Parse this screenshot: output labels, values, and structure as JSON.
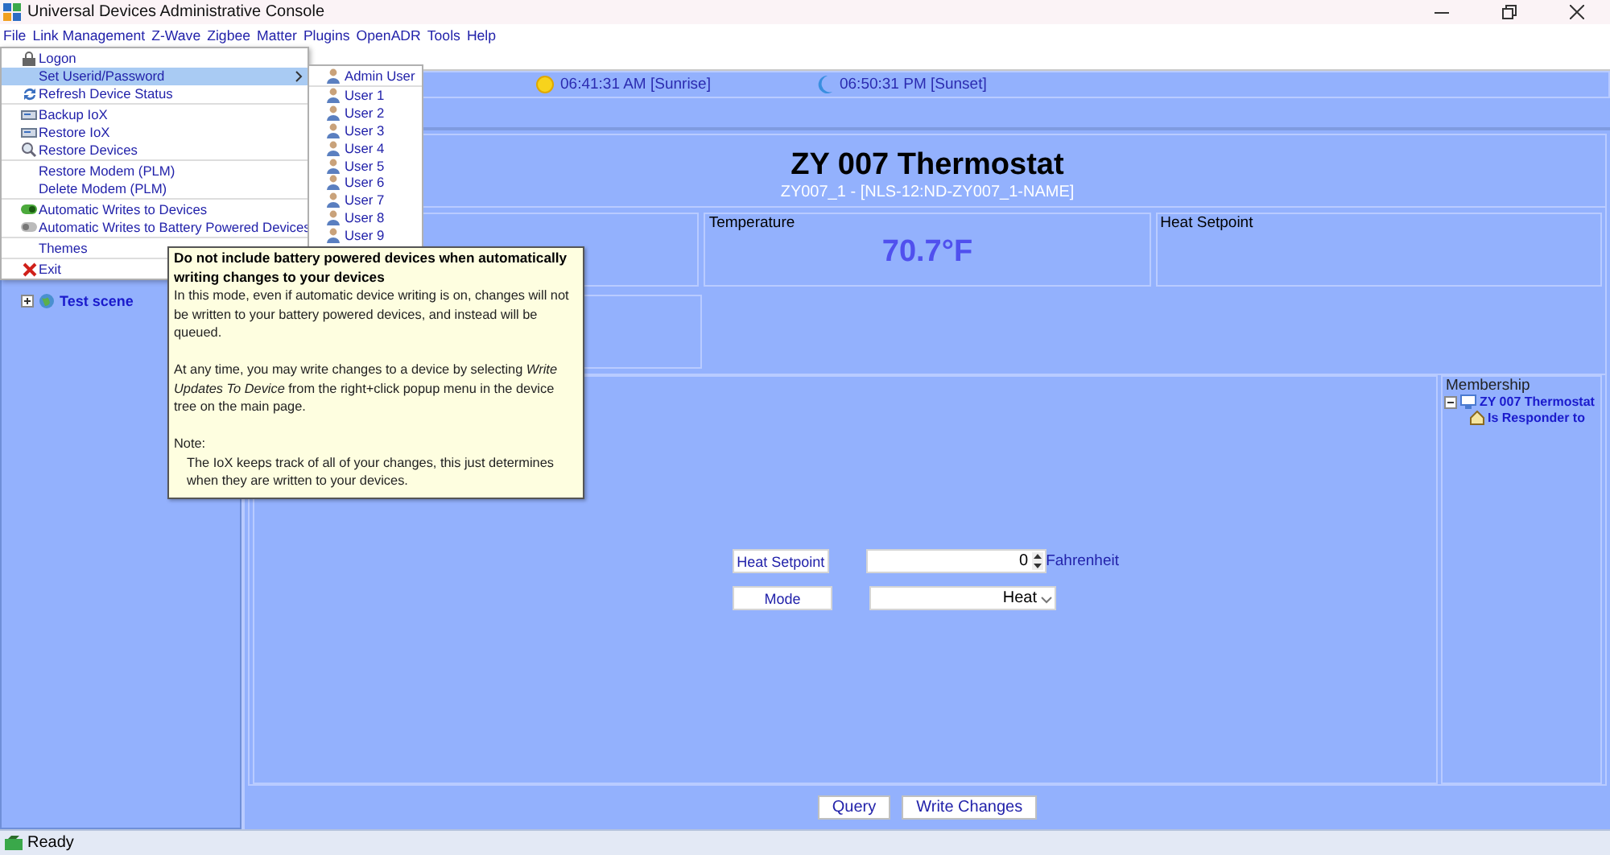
{
  "window": {
    "title": "Universal Devices Administrative Console"
  },
  "menu_bar": [
    "File",
    "Link Management",
    "Z-Wave",
    "Zigbee",
    "Matter",
    "Plugins",
    "OpenADR",
    "Tools",
    "Help"
  ],
  "file_menu": {
    "groups": [
      [
        {
          "label": "Logon",
          "selected": false
        },
        {
          "label": "Set Userid/Password",
          "selected": true
        },
        {
          "label": "Refresh Device Status",
          "selected": false
        }
      ],
      [
        {
          "label": "Backup IoX",
          "selected": false
        },
        {
          "label": "Restore IoX",
          "selected": false
        },
        {
          "label": "Restore Devices",
          "selected": false
        }
      ],
      [
        {
          "label": "Restore Modem (PLM)",
          "selected": false
        },
        {
          "label": "Delete Modem (PLM)",
          "selected": false
        }
      ],
      [
        {
          "label": "Automatic Writes to Devices",
          "selected": false
        },
        {
          "label": "Automatic Writes to Battery Powered Devices",
          "selected": false
        }
      ],
      [
        {
          "label": "Themes",
          "selected": false
        }
      ],
      [
        {
          "label": "Exit",
          "selected": false
        }
      ]
    ]
  },
  "user_submenu": [
    "Admin User",
    "User 1",
    "User 2",
    "User 3",
    "User 4",
    "User 5",
    "User 6",
    "User 7",
    "User 8",
    "User 9"
  ],
  "tooltip": {
    "title": "Do not include battery powered devices when automatically writing changes to your devices",
    "paragraphs": [
      "In this mode, even if automatic device writing is on, changes will not be written to your battery powered devices, and instead will be queued.",
      "At any time, you may write changes to a device by selecting *Write Updates To Device* from the right+click popup menu in the device tree on the main page.",
      "Note:"
    ],
    "note": "The IoX keeps track of all of your changes, this just determines when they are written to your devices."
  },
  "device_tree": [
    {
      "label": "Test scene",
      "expanded": false
    }
  ],
  "info_bar": {
    "sunrise": "06:41:31 AM [Sunrise]",
    "sunset": "06:50:31 PM [Sunset]"
  },
  "device": {
    "title": "ZY 007 Thermostat",
    "subtitle": "ZY007_1 - [NLS-12:ND-ZY007_1-NAME]",
    "cells": [
      {},
      {
        "label": "Temperature",
        "value": "70.7°F"
      },
      {
        "label": "Heat Setpoint"
      }
    ],
    "controls": [
      {
        "kind": "spinner",
        "button": "Heat Setpoint",
        "value": "0",
        "unit": "Fahrenheit"
      },
      {
        "kind": "dropdown",
        "button": "Mode",
        "value": "Heat"
      }
    ],
    "membership": {
      "title": "Membership",
      "tree": [
        {
          "label": "ZY 007 Thermostat",
          "expanded": true,
          "children": [
            {
              "label": "Is Responder to"
            }
          ]
        }
      ]
    }
  },
  "buttons": [
    "Query",
    "Write Changes"
  ],
  "status_bar": "Ready"
}
